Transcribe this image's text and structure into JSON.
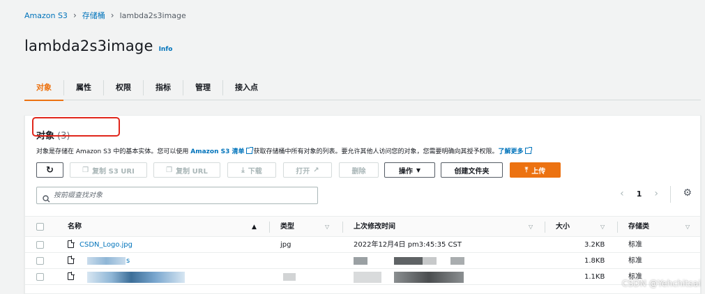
{
  "breadcrumb": {
    "root": "Amazon S3",
    "level1": "存储桶",
    "current": "lambda2s3image"
  },
  "page": {
    "title": "lambda2s3image",
    "info_label": "Info"
  },
  "tabs": [
    {
      "label": "对象",
      "active": true
    },
    {
      "label": "属性",
      "active": false
    },
    {
      "label": "权限",
      "active": false
    },
    {
      "label": "指标",
      "active": false
    },
    {
      "label": "管理",
      "active": false
    },
    {
      "label": "接入点",
      "active": false
    }
  ],
  "objects_panel": {
    "title": "对象",
    "count": "(3)",
    "description_part1": "对象是存储在 Amazon S3 中的基本实体。您可以使用 ",
    "description_link1": "Amazon S3 清单",
    "description_part2": "获取存储桶中所有对象的列表。要允许其他人访问您的对象，您需要明确向其授予权限。",
    "description_link2": "了解更多",
    "buttons": {
      "copy_s3_uri": "复制 S3 URI",
      "copy_url": "复制 URL",
      "download": "下载",
      "open": "打开",
      "delete": "删除",
      "actions": "操作",
      "create_folder": "创建文件夹",
      "upload": "上传"
    },
    "search_placeholder": "按前缀查找对象",
    "pagination": {
      "current_page": "1"
    }
  },
  "table": {
    "columns": [
      "名称",
      "类型",
      "上次修改时间",
      "大小",
      "存储类"
    ],
    "rows": [
      {
        "name": "CSDN_Logo.jpg",
        "type": "jpg",
        "modified": "2022年12月4日 pm3:45:35 CST",
        "size": "3.2KB",
        "storage": "标准"
      },
      {
        "name": "s",
        "type": "",
        "modified": "",
        "size": "1.8KB",
        "storage": "标准"
      },
      {
        "name": "",
        "type": "",
        "modified": "",
        "size": "1.1KB",
        "storage": "标准"
      }
    ]
  },
  "colors": {
    "accent": "#ec7211",
    "link": "#0073bb",
    "highlight": "#e0261b"
  },
  "watermark": "CSDN @Yehchitsai"
}
